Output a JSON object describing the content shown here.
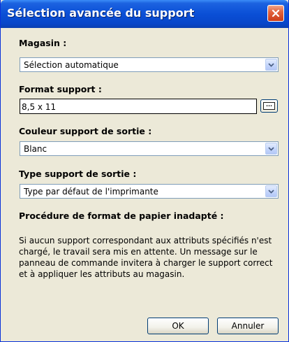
{
  "window": {
    "title": "Sélection avancée du support",
    "close_icon": "close-icon"
  },
  "fields": {
    "magasin": {
      "label": "Magasin :",
      "value": "Sélection automatique"
    },
    "format": {
      "label": "Format support :",
      "value": "8,5 x 11",
      "browse_icon": "ellipsis-icon"
    },
    "couleur": {
      "label": "Couleur support de sortie :",
      "value": "Blanc"
    },
    "type": {
      "label": "Type support de sortie :",
      "value": "Type par défaut de l'imprimante"
    }
  },
  "procedure": {
    "heading": "Procédure de format de papier inadapté :",
    "text": "Si aucun support correspondant aux attributs spécifiés n'est chargé, le travail sera mis en attente.  Un message sur le panneau de commande invitera à charger le support correct et à appliquer les attributs au magasin."
  },
  "buttons": {
    "ok": "OK",
    "cancel": "Annuler"
  },
  "colors": {
    "titlebar": "#0a4fd6",
    "dialog_background": "#ece9d8",
    "close_button": "#e2633e",
    "field_border": "#7f9db9"
  }
}
